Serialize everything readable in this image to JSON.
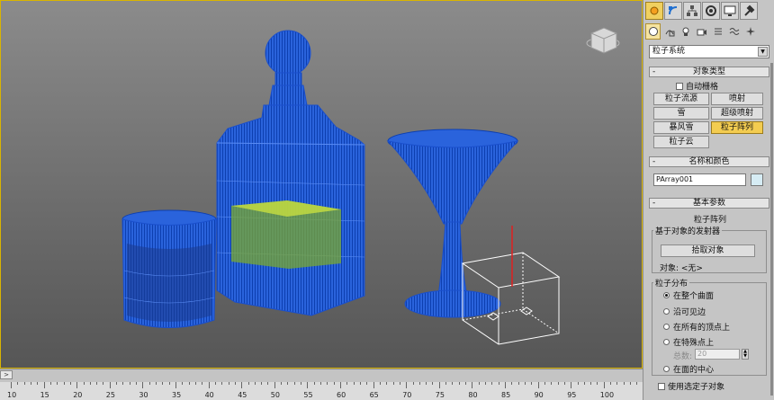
{
  "viewport": {
    "colors": {
      "wire": "#1e5fe0",
      "wire_light": "#3a7bf2",
      "liquid": "#c8e040",
      "emitter_box": "#ffffff",
      "axis": "#e02020"
    }
  },
  "timeline": {
    "arrow": ">",
    "ticks": [
      "10",
      "15",
      "20",
      "25",
      "30",
      "35",
      "40",
      "45",
      "50",
      "55",
      "60",
      "65",
      "70",
      "75",
      "80",
      "85",
      "90",
      "95",
      "100"
    ]
  },
  "panel": {
    "tabs": [
      "create-tab-icon",
      "modify-tab-icon",
      "hierarchy-tab-icon",
      "motion-tab-icon",
      "display-tab-icon",
      "utilities-tab-icon"
    ],
    "subtabs": [
      "geometry-icon",
      "shapes-icon",
      "lights-icon",
      "cameras-icon",
      "helpers-icon",
      "spacewarps-icon",
      "systems-icon"
    ],
    "category": "粒子系统",
    "object_type": {
      "title": "对象类型",
      "autogrid": "自动栅格",
      "buttons": [
        "粒子流源",
        "喷射",
        "雪",
        "超级喷射",
        "暴风雪",
        "粒子阵列",
        "粒子云"
      ],
      "active": "粒子阵列"
    },
    "name_color": {
      "title": "名称和颜色",
      "name": "PArray001",
      "color": "#d6ecf4"
    },
    "basic_params": {
      "title": "基本参数",
      "subtitle": "粒子阵列",
      "emitter_group": "基于对象的发射器",
      "pick_button": "拾取对象",
      "object_label": "对象: <无>"
    },
    "distribution": {
      "title": "粒子分布",
      "options": [
        "在整个曲面",
        "沿可见边",
        "在所有的顶点上",
        "在特殊点上",
        "在面的中心"
      ],
      "selected": 0,
      "total_label": "总数:",
      "total_value": "20",
      "use_selected": "使用选定子对象"
    }
  }
}
